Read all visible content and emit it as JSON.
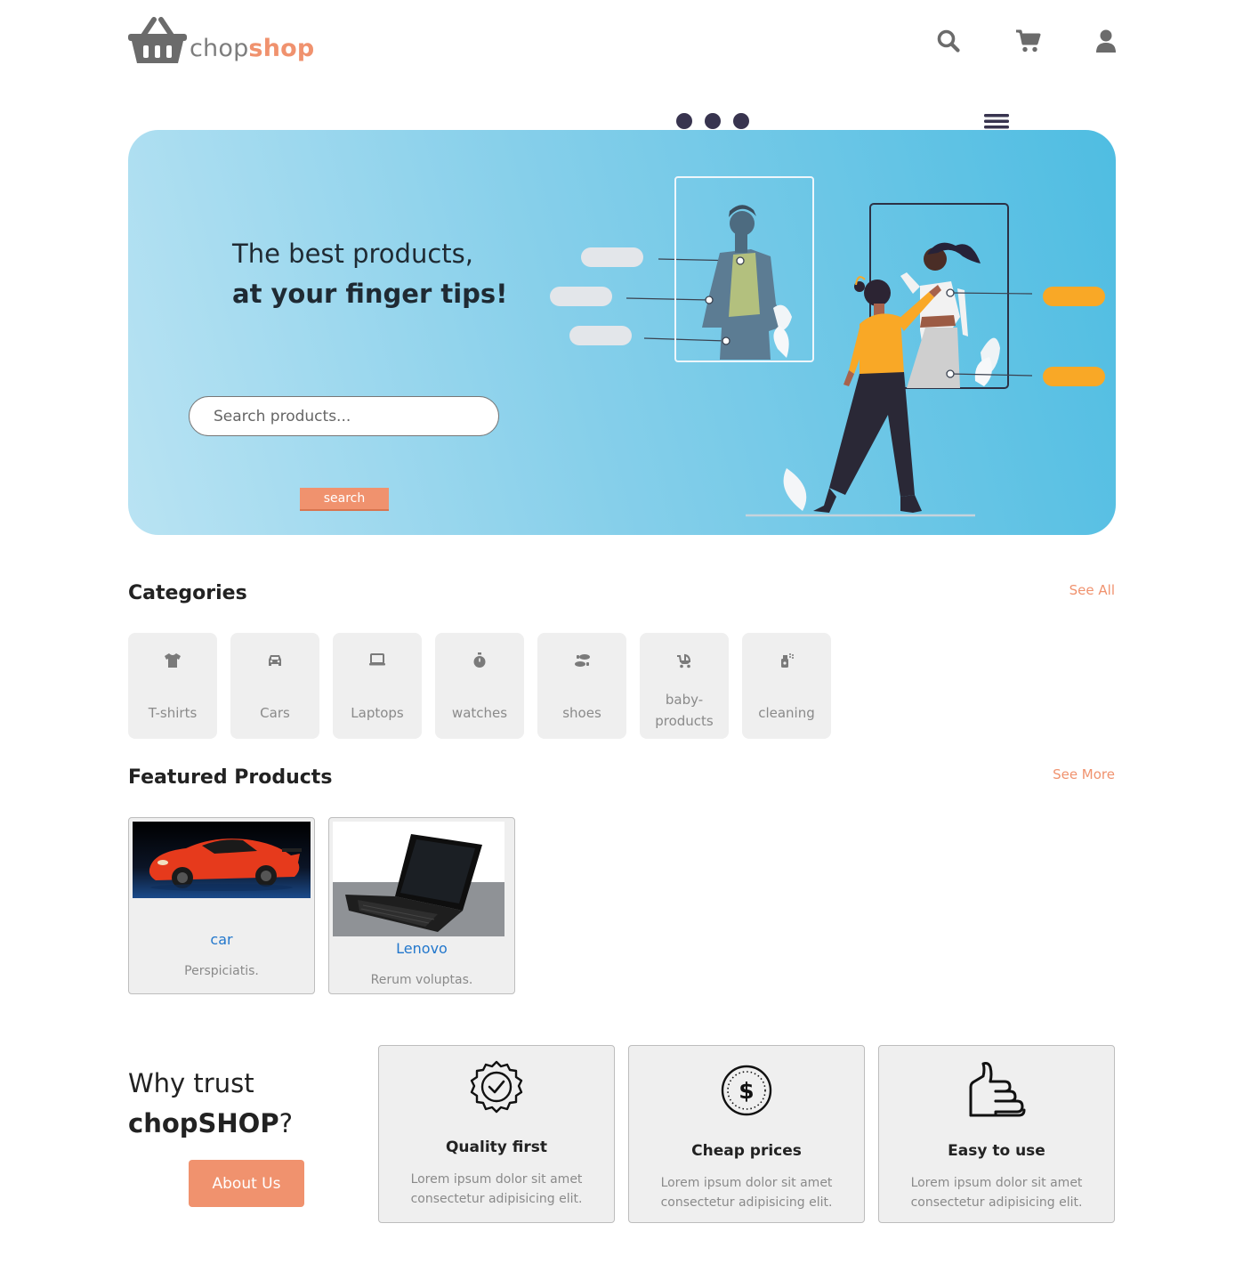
{
  "header": {
    "logo_part1": "chop",
    "logo_part2": "shop",
    "icons": [
      "search-icon",
      "cart-icon",
      "user-icon"
    ]
  },
  "hero": {
    "headline_line1": "The best products,",
    "headline_line2": "at your finger tips!",
    "search_placeholder": "Search products...",
    "search_button": "search"
  },
  "categories": {
    "title": "Categories",
    "see_all": "See All",
    "items": [
      {
        "label": "T-shirts",
        "icon": "tshirt-icon"
      },
      {
        "label": "Cars",
        "icon": "car-icon"
      },
      {
        "label": "Laptops",
        "icon": "laptop-icon"
      },
      {
        "label": "watches",
        "icon": "stopwatch-icon"
      },
      {
        "label": "shoes",
        "icon": "shoe-prints-icon"
      },
      {
        "label": "baby-products",
        "icon": "baby-carriage-icon"
      },
      {
        "label": "cleaning",
        "icon": "spray-bottle-icon"
      }
    ]
  },
  "featured": {
    "title": "Featured Products",
    "see_more": "See More",
    "products": [
      {
        "name": "car",
        "description": "Perspiciatis."
      },
      {
        "name": "Lenovo",
        "description": "Rerum voluptas."
      }
    ]
  },
  "why": {
    "line1": "Why trust",
    "brand": "chopSHOP",
    "question_mark": "?",
    "about_button": "About Us",
    "features": [
      {
        "title": "Quality first",
        "description": "Lorem ipsum dolor sit amet consectetur adipisicing elit.",
        "icon": "quality-badge-icon"
      },
      {
        "title": "Cheap prices",
        "description": "Lorem ipsum dolor sit amet consectetur adipisicing elit.",
        "icon": "dollar-coin-icon"
      },
      {
        "title": "Easy to use",
        "description": "Lorem ipsum dolor sit amet consectetur adipisicing elit.",
        "icon": "thumbs-up-icon"
      }
    ]
  },
  "colors": {
    "accent": "#f0926e",
    "hero_start": "#b9e3f3",
    "hero_end": "#4fbde2",
    "link_blue": "#2277cc",
    "card_bg": "#efefef"
  }
}
